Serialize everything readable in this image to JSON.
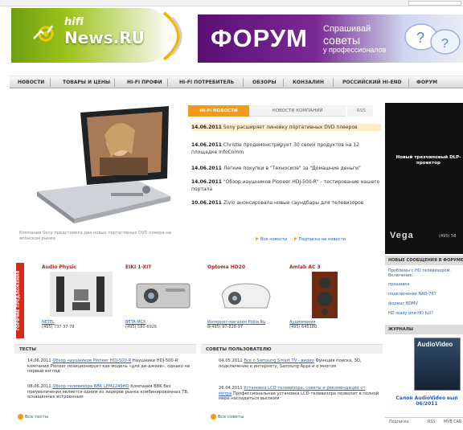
{
  "header": {
    "logo_hifi": "hifi",
    "logo_news": "News.RU",
    "top_links": [
      "",
      "",
      ""
    ],
    "banner": {
      "title": "ФОРУМ",
      "sub1": "Спрашивай",
      "sub2": "советы",
      "sub3": "у профессионалов"
    }
  },
  "nav": [
    "НОВОСТИ",
    "ТОВАРЫ И ЦЕНЫ",
    "HI-FI ПРОФИ",
    "HI-FI ПОТРЕБИТЕЛЬ",
    "ОБЗОРЫ",
    "КОНЗАЛИН",
    "РОССИЙСКИЙ HI-END",
    "ФОРУМ"
  ],
  "featured": {
    "caption": "Компания Sony представила два новых портативных DVD плеера на японском рынке"
  },
  "news_tabs": {
    "tab_hifi": "HI-FI НОВОСТИ",
    "tab_company": "НОВОСТИ КОМПАНИЙ",
    "rss": "RSS"
  },
  "news": [
    {
      "date": "14.06.2011",
      "text": "Sony расширяет линейку портативных DVD плееров"
    },
    {
      "date": "14.06.2011",
      "text": "Christie продемонстрирует 30 своих продуктов на 12 площадке InfoComm"
    },
    {
      "date": "14.06.2011",
      "text": "Легкие покупки в \"Техносиле\" за \"Домашние деньги\""
    },
    {
      "date": "14.06.2011",
      "text": "\"Обзор наушников Pioneer HDJ-500-R\" - тестирование нашего портала"
    },
    {
      "date": "10.06.2011",
      "text": "Zivio анонсировала новые саундбары для телевизоров"
    }
  ],
  "news_links": {
    "all": "Все новости",
    "subscribe": "Подписка на новости"
  },
  "sidebar": {
    "ad_text": "Новый трехчиповый DLP-проектор",
    "ad_brand": "Vega",
    "ad_phone": "(495) 58",
    "forum_header": "НОВЫЕ СООБЩЕНИЯ В ФОРУМЕ",
    "forum_links": [
      "Проблемы с HD телевизором. Включение.",
      "прошивка",
      "подключение NAD-767",
      "формат BDMV",
      "HD ready или HD full?"
    ],
    "journals_header": "ЖУРНАЛЫ",
    "magazine_title": "AudioVideo",
    "magazine_caption": "Салон AudioVideo вып 06/2011",
    "tabs": [
      "Подписка",
      "RSS",
      "MVB CAR"
    ]
  },
  "promo": {
    "band_label": "ГОРЯЧИЕ ПРЕДЛОЖЕНИЯ",
    "items": [
      {
        "title": "Audio Physic",
        "company": "NETEL",
        "phone": "(495) 737 37 78"
      },
      {
        "title": "EIKI 1-XIT",
        "company": "BETA-MCK",
        "phone": "(495) 580-6926"
      },
      {
        "title": "Optoma HD20",
        "company": "Интернет-магазин Pobia.Ru",
        "phone": "8(495) 97-828-97"
      },
      {
        "title": "Amlab AC 3",
        "company": "Аудиомания",
        "phone": "(495) 645180"
      }
    ]
  },
  "tests": {
    "header": "ТЕСТЫ",
    "entries": [
      {
        "date": "14.06.2011",
        "link": "Обзор наушников Pioneer HDJ-500-R",
        "text": "Наушники HDJ-500-R компании Pioneer позиционирует как модель «для ди-джеев», однако на первый взгляд"
      },
      {
        "date": "08.06.2011",
        "link": "Обзор телевизора BBK LEM2249HD",
        "text": "Компания BBK без преувеличения является одним из лидеров рынка комбинированных ТВ, оснащенных встроенным"
      }
    ],
    "more": "Все тесты"
  },
  "advice": {
    "header": "СОВЕТЫ ПОЛЬЗОВАТЕЛЮ",
    "entries": [
      {
        "date": "04.05.2011",
        "link": "Все о Samsung Smart TV - видео",
        "text": "Функция поиска, 3D, подключение к интернету, Samsung Apps и о многом"
      },
      {
        "date": "26.04.2011",
        "link": "Установка LCD телевизора: советы и рекомендации от мэтра",
        "text": "Профессиональная установка LCD-телевизора позволит в полной мере насладиться высоким"
      }
    ],
    "more": "Все советы"
  },
  "colors": {
    "accent": "#f29a1b",
    "promo_red": "#d42a1c",
    "link": "#2a5db0",
    "logo_green": "#8ab71a"
  }
}
